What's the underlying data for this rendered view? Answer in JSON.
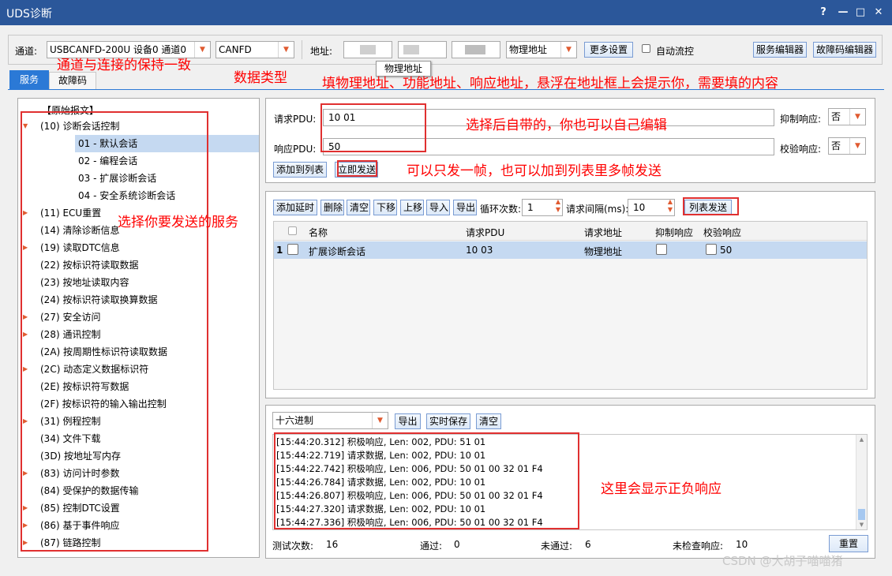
{
  "window": {
    "title": "UDS诊断",
    "help": "?",
    "minimize": "—",
    "maximize": "□",
    "close": "✕"
  },
  "toolbar": {
    "channel_label": "通道:",
    "channel_value": "USBCANFD-200U 设备0 通道0",
    "data_type_value": "CANFD",
    "address_label": "地址:",
    "address_mode": "物理地址",
    "more_settings": "更多设置",
    "auto_flow_label": "自动流控",
    "service_editor": "服务编辑器",
    "dtc_editor": "故障码编辑器",
    "tooltip": "物理地址"
  },
  "tabs": [
    {
      "label": "服务"
    },
    {
      "label": "故障码"
    }
  ],
  "tree": {
    "root": "【原始报文】",
    "items": [
      {
        "label": "(10) 诊断会话控制",
        "expanded": true
      },
      {
        "label": "01 - 默认会话",
        "child": true,
        "selected": true
      },
      {
        "label": "02 - 编程会话",
        "child": true
      },
      {
        "label": "03 - 扩展诊断会话",
        "child": true
      },
      {
        "label": "04 - 安全系统诊断会话",
        "child": true
      },
      {
        "label": "(11) ECU重置",
        "arrow": true
      },
      {
        "label": "(14) 清除诊断信息"
      },
      {
        "label": "(19) 读取DTC信息",
        "arrow": true
      },
      {
        "label": "(22) 按标识符读取数据"
      },
      {
        "label": "(23) 按地址读取内容"
      },
      {
        "label": "(24) 按标识符读取换算数据"
      },
      {
        "label": "(27) 安全访问",
        "arrow": true
      },
      {
        "label": "(28) 通讯控制",
        "arrow": true
      },
      {
        "label": "(2A) 按周期性标识符读取数据"
      },
      {
        "label": "(2C) 动态定义数据标识符",
        "arrow": true
      },
      {
        "label": "(2E) 按标识符写数据"
      },
      {
        "label": "(2F) 按标识符的输入输出控制"
      },
      {
        "label": "(31) 例程控制",
        "arrow": true
      },
      {
        "label": "(34) 文件下载"
      },
      {
        "label": "(3D) 按地址写内存"
      },
      {
        "label": "(83) 访问计时参数",
        "arrow": true
      },
      {
        "label": "(84) 受保护的数据传输"
      },
      {
        "label": "(85) 控制DTC设置",
        "arrow": true
      },
      {
        "label": "(86) 基于事件响应",
        "arrow": true
      },
      {
        "label": "(87) 链路控制",
        "arrow": true
      }
    ]
  },
  "request": {
    "request_pdu_label": "请求PDU:",
    "request_pdu_value": "10 01",
    "response_pdu_label": "响应PDU:",
    "response_pdu_value": "50",
    "suppress_label": "抑制响应:",
    "suppress_value": "否",
    "verify_label": "校验响应:",
    "verify_value": "否",
    "add_to_list": "添加到列表",
    "send_now": "立即发送"
  },
  "list_toolbar": {
    "add_delay": "添加延时",
    "delete": "删除",
    "clear": "清空",
    "move_down": "下移",
    "move_up": "上移",
    "import": "导入",
    "export": "导出",
    "loop_label": "循环次数:",
    "loop_value": "1",
    "interval_label": "请求间隔(ms):",
    "interval_value": "10",
    "list_send": "列表发送"
  },
  "table": {
    "headers": [
      "名称",
      "请求PDU",
      "请求地址",
      "抑制响应",
      "校验响应"
    ],
    "rows": [
      {
        "index": "1",
        "name": "扩展诊断会话",
        "pdu": "10 03",
        "address": "物理地址",
        "verify": "50"
      }
    ]
  },
  "log": {
    "format_value": "十六进制",
    "export": "导出",
    "realtime_save": "实时保存",
    "clear": "清空",
    "lines": [
      "[15:44:20.312] 积极响应, Len: 002, PDU: 51 01",
      "[15:44:22.719] 请求数据, Len: 002, PDU: 10 01",
      "[15:44:22.742] 积极响应, Len: 006, PDU: 50 01 00 32 01 F4",
      "[15:44:26.784] 请求数据, Len: 002, PDU: 10 01",
      "[15:44:26.807] 积极响应, Len: 006, PDU: 50 01 00 32 01 F4",
      "[15:44:27.320] 请求数据, Len: 002, PDU: 10 01",
      "[15:44:27.336] 积极响应, Len: 006, PDU: 50 01 00 32 01 F4"
    ]
  },
  "stats": {
    "test_count_label": "测试次数:",
    "test_count": "16",
    "pass_label": "通过:",
    "pass": "0",
    "fail_label": "未通过:",
    "fail": "6",
    "unchecked_label": "未检查响应:",
    "unchecked": "10",
    "reset": "重置"
  },
  "annotations": {
    "channel_note": "通道与连接的保持一致",
    "datatype_note": "数据类型",
    "address_note": "填物理地址、功能地址、响应地址，悬浮在地址框上会提示你，需要填的内容",
    "pdu_note": "选择后自带的，你也可以自己编辑",
    "send_note": "可以只发一帧，也可以加到列表里多帧发送",
    "service_note": "选择你要发送的服务",
    "response_note": "这里会显示正负响应"
  },
  "watermark": "CSDN @大胡子喵喵猪",
  "colors": {
    "titlebar": "#2b579a",
    "annotation": "#ff0000",
    "selected": "#c5d9f1"
  }
}
